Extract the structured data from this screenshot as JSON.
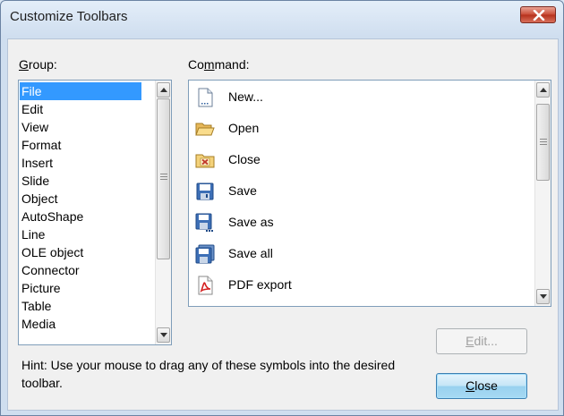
{
  "window": {
    "title": "Customize Toolbars"
  },
  "group": {
    "label_accel": "G",
    "label_rest": "roup:",
    "items": [
      "File",
      "Edit",
      "View",
      "Format",
      "Insert",
      "Slide",
      "Object",
      "AutoShape",
      "Line",
      "OLE object",
      "Connector",
      "Picture",
      "Table",
      "Media"
    ],
    "selected": "File"
  },
  "command": {
    "label_pre": "Co",
    "label_accel": "m",
    "label_post": "mand:",
    "items": [
      {
        "label": "New...",
        "icon": "new-document-icon"
      },
      {
        "label": "Open",
        "icon": "open-folder-icon"
      },
      {
        "label": "Close",
        "icon": "close-folder-icon"
      },
      {
        "label": "Save",
        "icon": "save-icon"
      },
      {
        "label": "Save as",
        "icon": "save-as-icon"
      },
      {
        "label": "Save all",
        "icon": "save-all-icon"
      },
      {
        "label": "PDF export",
        "icon": "pdf-icon"
      }
    ]
  },
  "buttons": {
    "edit_accel": "E",
    "edit_rest": "dit...",
    "close_accel": "C",
    "close_rest": "lose"
  },
  "hint": "Hint: Use your mouse to drag any of these symbols into the desired toolbar.",
  "colors": {
    "selection": "#3399ff",
    "title_close": "#c94a34"
  }
}
